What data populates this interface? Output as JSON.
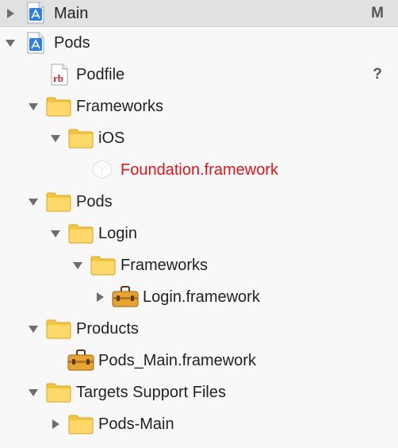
{
  "navigator": {
    "rows": [
      {
        "label": "Main",
        "badge": "M",
        "icon": "xcode-project-icon",
        "disclosure": "collapsed",
        "selected": true
      },
      {
        "label": "Pods",
        "icon": "xcode-project-icon",
        "disclosure": "expanded"
      },
      {
        "label": "Podfile",
        "badge": "?",
        "icon": "ruby-file-icon",
        "disclosure": "none"
      },
      {
        "label": "Frameworks",
        "icon": "folder-icon",
        "disclosure": "expanded"
      },
      {
        "label": "iOS",
        "icon": "folder-icon",
        "disclosure": "expanded"
      },
      {
        "label": "Foundation.framework",
        "icon": "framework-missing-icon",
        "disclosure": "none",
        "missing": true,
        "missing_color": "#e0161b"
      },
      {
        "label": "Pods",
        "icon": "folder-icon",
        "disclosure": "expanded"
      },
      {
        "label": "Login",
        "icon": "folder-icon",
        "disclosure": "expanded"
      },
      {
        "label": "Frameworks",
        "icon": "folder-icon",
        "disclosure": "expanded"
      },
      {
        "label": "Login.framework",
        "icon": "toolbox-icon",
        "disclosure": "collapsed"
      },
      {
        "label": "Products",
        "icon": "folder-icon",
        "disclosure": "expanded"
      },
      {
        "label": "Pods_Main.framework",
        "icon": "toolbox-icon",
        "disclosure": "none"
      },
      {
        "label": "Targets Support Files",
        "icon": "folder-icon",
        "disclosure": "expanded"
      },
      {
        "label": "Pods-Main",
        "icon": "folder-icon",
        "disclosure": "collapsed"
      }
    ]
  }
}
